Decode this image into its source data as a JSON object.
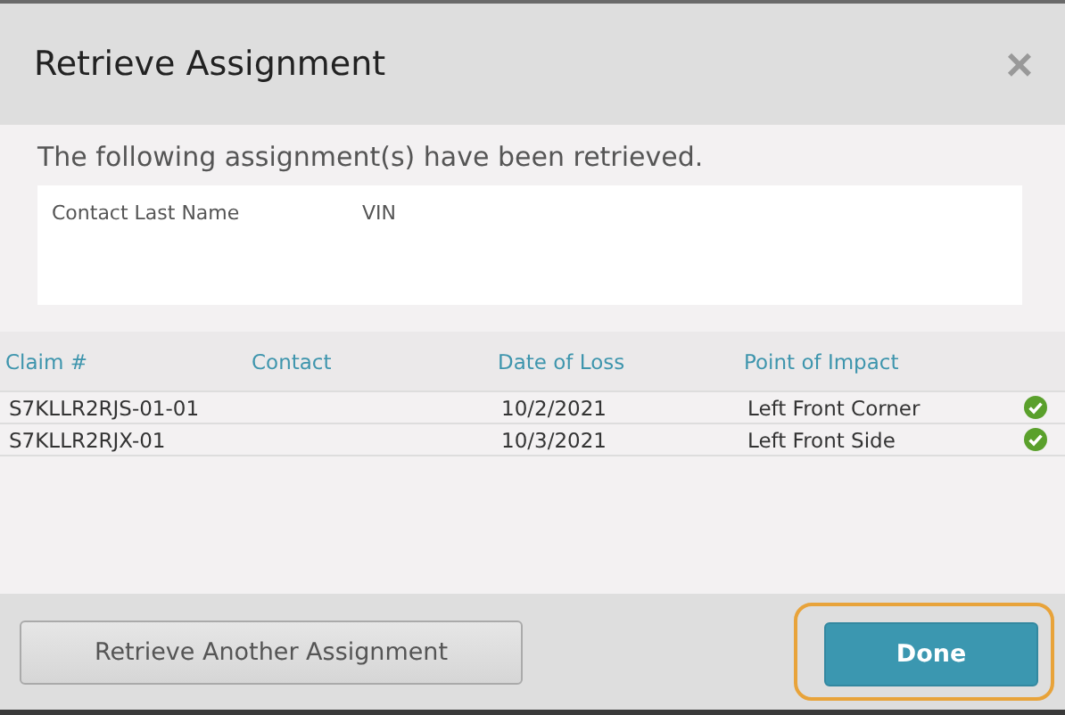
{
  "dialog": {
    "title": "Retrieve Assignment",
    "close": "×"
  },
  "message": "The following assignment(s) have been retrieved.",
  "criteria": [
    "Contact Last Name",
    "VIN"
  ],
  "table": {
    "columns": [
      "Claim #",
      "Contact",
      "Date of Loss",
      "Point of Impact"
    ],
    "rows": [
      {
        "claim": "S7KLLR2RJS-01-01",
        "contact": "",
        "date": "10/2/2021",
        "impact": "Left Front Corner",
        "retrieved": true
      },
      {
        "claim": "S7KLLR2RJX-01",
        "contact": "",
        "date": "10/3/2021",
        "impact": "Left Front Side",
        "retrieved": true
      }
    ]
  },
  "buttons": [
    {
      "label": "Retrieve Another Assignment",
      "kind": "secondary",
      "focused": false
    },
    {
      "label": "Done",
      "kind": "primary",
      "focused": true
    }
  ]
}
